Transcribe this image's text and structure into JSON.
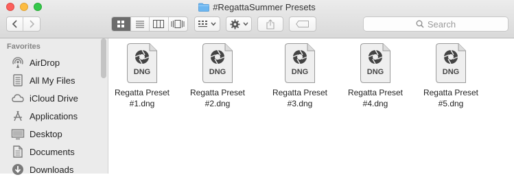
{
  "window": {
    "title": "#RegattaSummer Presets"
  },
  "toolbar": {
    "search_placeholder": "Search"
  },
  "sidebar": {
    "heading": "Favorites",
    "items": [
      {
        "label": "AirDrop",
        "icon": "airdrop-icon"
      },
      {
        "label": "All My Files",
        "icon": "all-files-icon"
      },
      {
        "label": "iCloud Drive",
        "icon": "cloud-icon"
      },
      {
        "label": "Applications",
        "icon": "applications-icon"
      },
      {
        "label": "Desktop",
        "icon": "desktop-icon"
      },
      {
        "label": "Documents",
        "icon": "documents-icon"
      },
      {
        "label": "Downloads",
        "icon": "downloads-icon"
      }
    ]
  },
  "files": [
    {
      "line1": "Regatta Preset",
      "line2": "#1.dng",
      "badge": "DNG"
    },
    {
      "line1": "Regatta Preset",
      "line2": "#2.dng",
      "badge": "DNG"
    },
    {
      "line1": "Regatta Preset",
      "line2": "#3.dng",
      "badge": "DNG"
    },
    {
      "line1": "Regatta Preset",
      "line2": "#4.dng",
      "badge": "DNG"
    },
    {
      "line1": "Regatta Preset",
      "line2": "#5.dng",
      "badge": "DNG"
    }
  ]
}
